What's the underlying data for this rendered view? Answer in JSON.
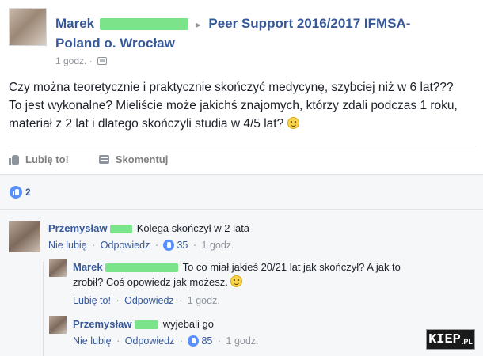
{
  "post": {
    "author": "Marek",
    "group": "Peer Support 2016/2017 IFMSA-Poland o. Wrocław",
    "time": "1 godz.",
    "body": "Czy można teoretycznie i praktycznie skończyć medycynę, szybciej niż w 6 lat??? To jest wykonalne? Mieliście może jakichś znajomych, którzy zdali podczas 1 roku, materiał z 2 lat i dlatego skończyli studia w 4/5 lat?",
    "like_action": "Lubię to!",
    "comment_action": "Skomentuj",
    "reaction_count": "2"
  },
  "comments": [
    {
      "author": "Przemysław",
      "text": "Kolega skończył w 2 lata",
      "actions": {
        "like": "Nie lubię",
        "reply": "Odpowiedz",
        "likes": "35",
        "time": "1 godz."
      }
    },
    {
      "author": "Marek",
      "text_line1": "To co miał jakieś 20/21 lat jak skończył? A jak to",
      "text_line2": "zrobił? Coś opowiedz jak możesz.",
      "actions": {
        "like": "Lubię to!",
        "reply": "Odpowiedz",
        "time": "1 godz."
      }
    },
    {
      "author": "Przemysław",
      "text": "wyjebali go",
      "actions": {
        "like": "Nie lubię",
        "reply": "Odpowiedz",
        "likes": "85",
        "time": "1 godz."
      }
    }
  ],
  "separator": "·",
  "arrow": "▸",
  "watermark": {
    "main": "KIEP",
    "suffix": ".PL"
  },
  "colors": {
    "link": "#365899",
    "muted": "#90949c",
    "like_blue": "#5890ff",
    "censor_green": "#6ee07d"
  },
  "icons": [
    "like-icon",
    "comment-icon",
    "privacy-icon",
    "smiley-icon"
  ]
}
